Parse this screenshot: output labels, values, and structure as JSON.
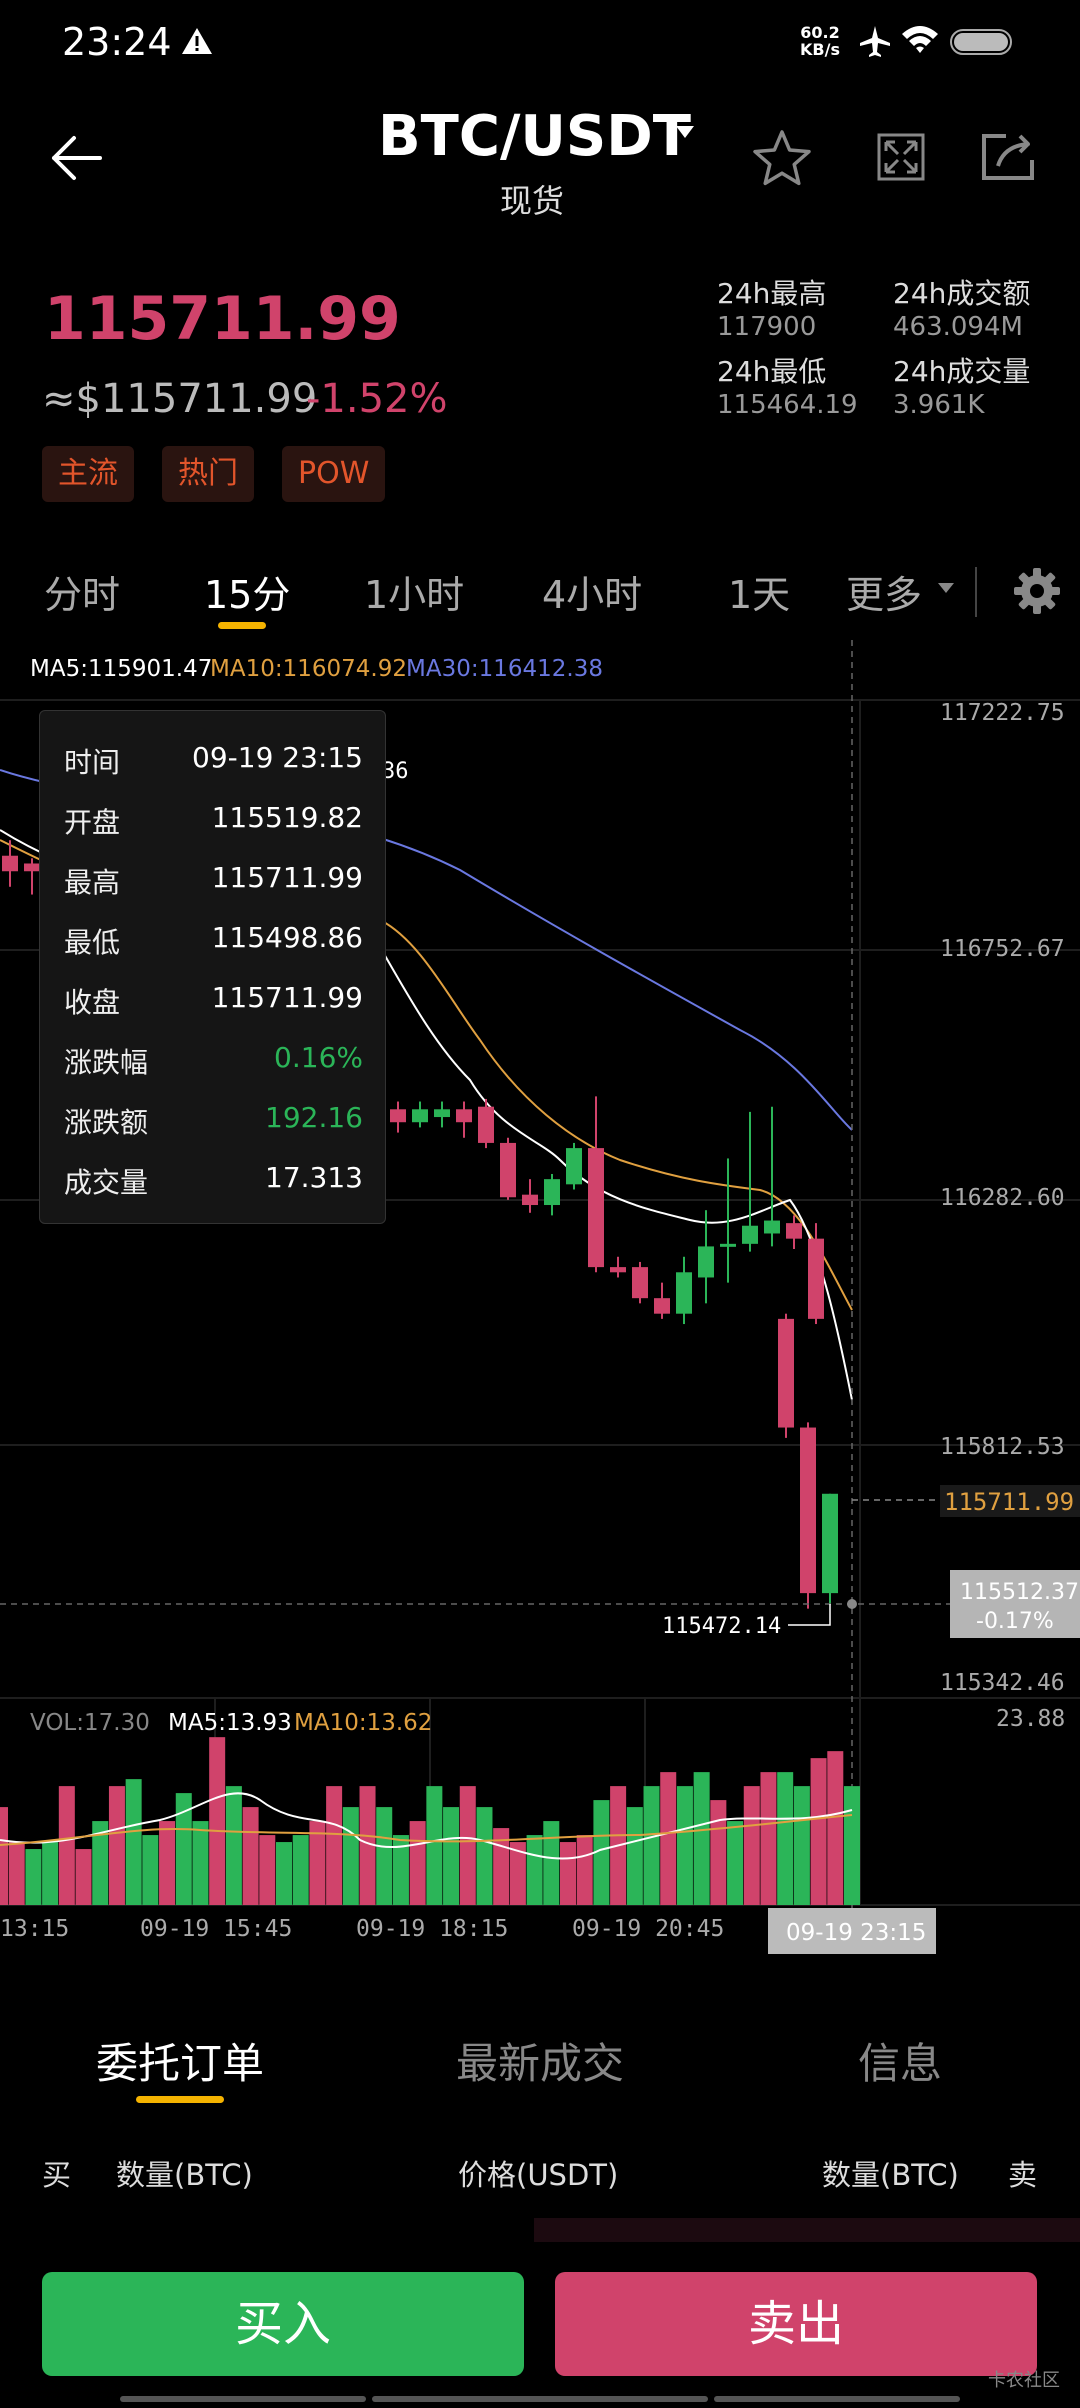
{
  "status": {
    "time": "23:24",
    "net_speed_value": "60.2",
    "net_speed_unit": "KB/s"
  },
  "header": {
    "pair": "BTC/USDT",
    "market": "现货"
  },
  "price": {
    "last": "115711.99",
    "usd": "≈$115711.99",
    "change": "-1.52%"
  },
  "tags": [
    "主流",
    "热门",
    "POW"
  ],
  "stats": [
    {
      "label": "24h最高",
      "value": "117900"
    },
    {
      "label": "24h成交额",
      "value": "463.094M"
    },
    {
      "label": "24h最低",
      "value": "115464.19"
    },
    {
      "label": "24h成交量",
      "value": "3.961K"
    }
  ],
  "timeframes": [
    "分时",
    "15分",
    "1小时",
    "4小时",
    "1天",
    "更多"
  ],
  "ma_legend": {
    "ma5": "MA5:115901.47",
    "ma10": "MA10:116074.92",
    "ma30": "MA30:116412.38"
  },
  "tooltip": [
    {
      "k": "时间",
      "v": "09-19 23:15"
    },
    {
      "k": "开盘",
      "v": "115519.82"
    },
    {
      "k": "最高",
      "v": "115711.99"
    },
    {
      "k": "最低",
      "v": "115498.86"
    },
    {
      "k": "收盘",
      "v": "115711.99"
    },
    {
      "k": "涨跌幅",
      "v": "0.16%"
    },
    {
      "k": "涨跌额",
      "v": "192.16"
    },
    {
      "k": "成交量",
      "v": "17.313"
    }
  ],
  "colors": {
    "up": "#2bb558",
    "down": "#d0436b",
    "ma5": "#ffffff",
    "ma10": "#e0a040",
    "ma30": "#6a78e0",
    "accent": "#f5b300"
  },
  "chart_data": {
    "type": "candlestick",
    "price_axis": {
      "ticks": [
        "117222.75",
        "116752.67",
        "116282.60",
        "115812.53",
        "115342.46"
      ],
      "ylim": [
        115342.46,
        117222.75
      ]
    },
    "peak_label_fragment": "36",
    "low_marker": "115472.14",
    "last_price_label": "115711.99",
    "crosshair_price": "115512.37",
    "crosshair_change": "-0.17%",
    "time_axis": [
      "13:15",
      "09-19 15:45",
      "09-19 18:15",
      "09-19 20:45"
    ],
    "crosshair_time": "09-19 23:15",
    "volume": {
      "vol_label": "VOL:17.30",
      "ma5_label": "MA5:13.93",
      "ma10_label": "MA10:13.62",
      "max_label": "23.88",
      "ymax": 23.88
    },
    "candles": [
      {
        "o": 116945,
        "c": 116915,
        "h": 116975,
        "l": 116885
      },
      {
        "o": 116930,
        "c": 116915,
        "h": 116940,
        "l": 116870
      },
      {
        "o": 116455,
        "c": 116430,
        "h": 116470,
        "l": 116410
      },
      {
        "o": 116430,
        "c": 116455,
        "h": 116470,
        "l": 116420
      },
      {
        "o": 116440,
        "c": 116455,
        "h": 116470,
        "l": 116420
      },
      {
        "o": 116455,
        "c": 116430,
        "h": 116470,
        "l": 116400
      },
      {
        "o": 116460,
        "c": 116390,
        "h": 116475,
        "l": 116380
      },
      {
        "o": 116390,
        "c": 116285,
        "h": 116400,
        "l": 116280
      },
      {
        "o": 116290,
        "c": 116270,
        "h": 116320,
        "l": 116255
      },
      {
        "o": 116270,
        "c": 116320,
        "h": 116330,
        "l": 116250
      },
      {
        "o": 116310,
        "c": 116380,
        "h": 116390,
        "l": 116300
      },
      {
        "o": 116380,
        "c": 116150,
        "h": 116480,
        "l": 116140
      },
      {
        "o": 116150,
        "c": 116140,
        "h": 116170,
        "l": 116130
      },
      {
        "o": 116150,
        "c": 116090,
        "h": 116160,
        "l": 116080
      },
      {
        "o": 116090,
        "c": 116060,
        "h": 116120,
        "l": 116050
      },
      {
        "o": 116060,
        "c": 116140,
        "h": 116170,
        "l": 116040
      },
      {
        "o": 116130,
        "c": 116190,
        "h": 116260,
        "l": 116080
      },
      {
        "o": 116195,
        "c": 116195,
        "h": 116360,
        "l": 116120
      },
      {
        "o": 116195,
        "c": 116230,
        "h": 116450,
        "l": 116180
      },
      {
        "o": 116215,
        "c": 116240,
        "h": 116460,
        "l": 116190
      },
      {
        "o": 116235,
        "c": 116205,
        "h": 116250,
        "l": 116185
      },
      {
        "o": 116205,
        "c": 116050,
        "h": 116235,
        "l": 116040
      },
      {
        "o": 116050,
        "c": 115840,
        "h": 116060,
        "l": 115820
      },
      {
        "o": 115840,
        "c": 115520,
        "h": 115850,
        "l": 115490
      },
      {
        "o": 115520,
        "c": 115712,
        "h": 115712,
        "l": 115499
      }
    ],
    "volumes": [
      14,
      9,
      8,
      9,
      17,
      8,
      12,
      17,
      18,
      10,
      12,
      16,
      12,
      24,
      17,
      14,
      10,
      9,
      10,
      12,
      17,
      14,
      17,
      14,
      10,
      12,
      17,
      14,
      17,
      14,
      11,
      9,
      10,
      12,
      9,
      10,
      15,
      17,
      14,
      17,
      19,
      17,
      19,
      15,
      12,
      17,
      19,
      19,
      17,
      21,
      22,
      17
    ]
  },
  "bottom_tabs": [
    "委托订单",
    "最新成交",
    "信息"
  ],
  "order_columns": [
    "买",
    "数量(BTC)",
    "价格(USDT)",
    "数量(BTC)",
    "卖"
  ],
  "actions": {
    "buy": "买入",
    "sell": "卖出"
  },
  "watermark": "卡农社区"
}
